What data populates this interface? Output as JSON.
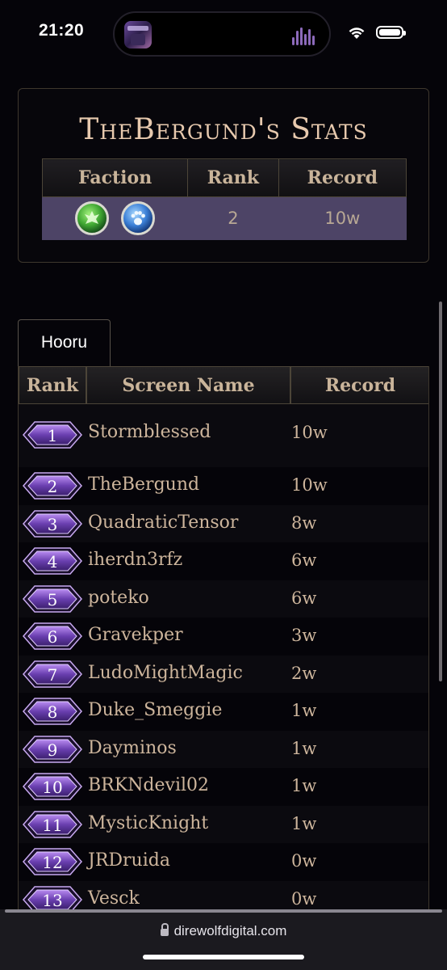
{
  "status_bar": {
    "time": "21:20"
  },
  "stats": {
    "title": "TheBergund's Stats",
    "headers": {
      "faction": "Faction",
      "rank": "Rank",
      "record": "Record"
    },
    "rank": "2",
    "record": "10w",
    "faction_icons": [
      "green-faction-icon",
      "blue-faction-icon"
    ]
  },
  "faction_tab": {
    "label": "Hooru"
  },
  "leaderboard": {
    "headers": {
      "rank": "Rank",
      "screen_name": "Screen Name",
      "record": "Record"
    },
    "rows": [
      {
        "rank": "1",
        "name": "Stormblessed",
        "record": "10w"
      },
      {
        "rank": "2",
        "name": "TheBergund",
        "record": "10w"
      },
      {
        "rank": "3",
        "name": "QuadraticTensor",
        "record": "8w"
      },
      {
        "rank": "4",
        "name": "iherdn3rfz",
        "record": "6w"
      },
      {
        "rank": "5",
        "name": "poteko",
        "record": "6w"
      },
      {
        "rank": "6",
        "name": "Gravekper",
        "record": "3w"
      },
      {
        "rank": "7",
        "name": "LudoMightMagic",
        "record": "2w"
      },
      {
        "rank": "8",
        "name": "Duke_Smeggie",
        "record": "1w"
      },
      {
        "rank": "9",
        "name": "Dayminos",
        "record": "1w"
      },
      {
        "rank": "10",
        "name": "BRKNdevil02",
        "record": "1w"
      },
      {
        "rank": "11",
        "name": "MysticKnight",
        "record": "1w"
      },
      {
        "rank": "12",
        "name": "JRDruida",
        "record": "0w"
      },
      {
        "rank": "13",
        "name": "Vesck",
        "record": "0w"
      }
    ]
  },
  "browser": {
    "url": "direwolfdigital.com"
  },
  "colors": {
    "background": "#050409",
    "accent_purple": "#6a3fb0",
    "stats_row": "#4d4466",
    "text_gold": "#cdb59c"
  }
}
